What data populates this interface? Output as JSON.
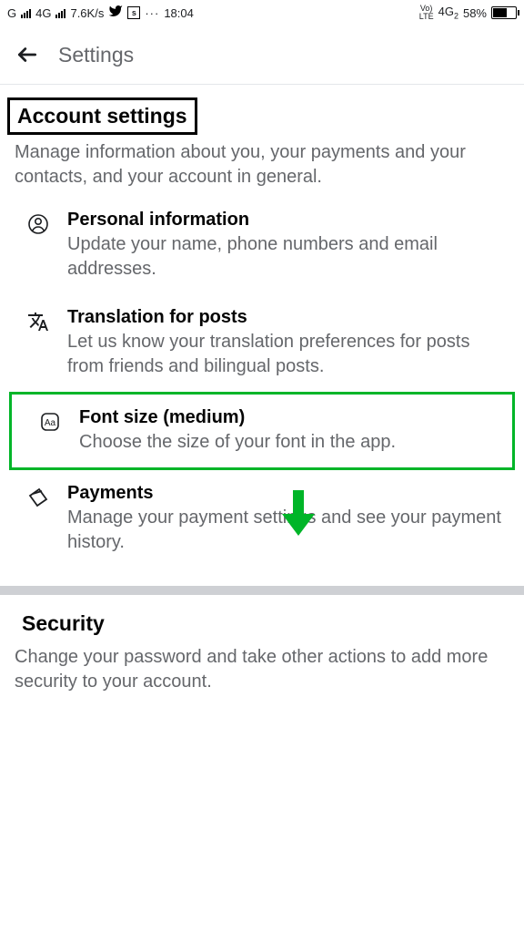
{
  "statusBar": {
    "carrier1": "G",
    "net1": "4G",
    "speed": "7.6K/s",
    "time": "18:04",
    "volte": "Vo)",
    "lte": "LTE",
    "net2": "4G",
    "net2sub": "2",
    "battery": "58%"
  },
  "header": {
    "title": "Settings"
  },
  "accountSection": {
    "title": "Account settings",
    "desc": "Manage information about you, your payments and your contacts, and your account in general."
  },
  "items": {
    "personal": {
      "title": "Personal information",
      "desc": "Update your name, phone numbers and email addresses."
    },
    "translation": {
      "title": "Translation for posts",
      "desc": "Let us know your translation preferences for posts from friends and bilingual posts."
    },
    "fontsize": {
      "title": "Font size (medium)",
      "desc": "Choose the size of your font in the app."
    },
    "payments": {
      "title": "Payments",
      "desc": "Manage your payment settings and see your payment history."
    }
  },
  "securitySection": {
    "title": "Security",
    "desc": "Change your password and take other actions to add more security to your account."
  }
}
